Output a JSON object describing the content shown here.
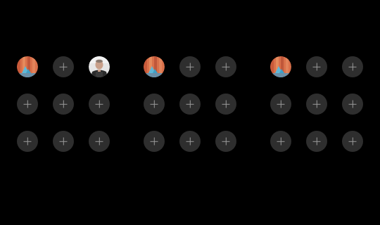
{
  "screen": {
    "background": "#000000"
  },
  "slot_style": {
    "add_background": "#2e2e2e",
    "add_icon_color": "#9a9a9a",
    "add_icon": "plus-icon"
  },
  "groups": [
    {
      "name": "group-1",
      "slots": [
        {
          "type": "avatar",
          "photo": "orange-pattern-photo"
        },
        {
          "type": "add"
        },
        {
          "type": "avatar",
          "photo": "man-portrait-photo"
        },
        {
          "type": "add"
        },
        {
          "type": "add"
        },
        {
          "type": "add"
        },
        {
          "type": "add"
        },
        {
          "type": "add"
        },
        {
          "type": "add"
        }
      ]
    },
    {
      "name": "group-2",
      "slots": [
        {
          "type": "avatar",
          "photo": "orange-pattern-photo"
        },
        {
          "type": "add"
        },
        {
          "type": "add"
        },
        {
          "type": "add"
        },
        {
          "type": "add"
        },
        {
          "type": "add"
        },
        {
          "type": "add"
        },
        {
          "type": "add"
        },
        {
          "type": "add"
        }
      ]
    },
    {
      "name": "group-3",
      "slots": [
        {
          "type": "avatar",
          "photo": "orange-pattern-photo"
        },
        {
          "type": "add"
        },
        {
          "type": "add"
        },
        {
          "type": "add"
        },
        {
          "type": "add"
        },
        {
          "type": "add"
        },
        {
          "type": "add"
        },
        {
          "type": "add"
        },
        {
          "type": "add"
        }
      ]
    }
  ]
}
